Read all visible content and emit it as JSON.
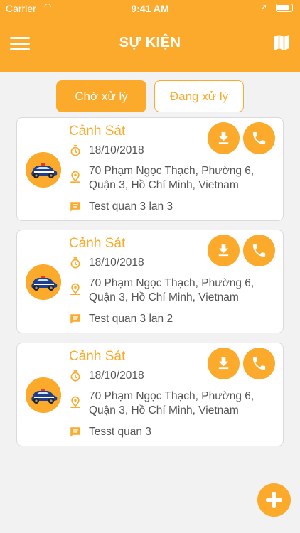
{
  "status_bar": {
    "carrier": "Carrier",
    "time": "9:41 AM"
  },
  "header": {
    "title": "SỰ KIỆN",
    "menu_icon": "hamburger-menu-icon",
    "map_icon": "map-icon"
  },
  "tabs": [
    {
      "label": "Chờ xử lý",
      "active": true
    },
    {
      "label": "Đang xử lý",
      "active": false
    }
  ],
  "events": [
    {
      "title": "Cảnh Sát",
      "date": "18/10/2018",
      "address": "70 Phạm Ngọc Thạch, Phường 6, Quận 3, Hồ Chí Minh, Vietnam",
      "note": "Test quan 3 lan 3"
    },
    {
      "title": "Cảnh Sát",
      "date": "18/10/2018",
      "address": "70 Phạm Ngọc Thạch, Phường 6, Quận 3, Hồ Chí Minh, Vietnam",
      "note": "Test quan 3 lan 2"
    },
    {
      "title": "Cảnh Sát",
      "date": "18/10/2018",
      "address": "70 Phạm Ngọc Thạch, Phường 6, Quận 3, Hồ Chí Minh, Vietnam",
      "note": "Tesst quan 3"
    }
  ],
  "colors": {
    "accent": "#fbaa2b",
    "background": "#f2f2f2",
    "text": "#555555"
  },
  "icons": {
    "date": "timer-icon",
    "location": "location-pin-icon",
    "note": "message-icon",
    "download": "download-icon",
    "call": "phone-icon",
    "add": "plus-icon",
    "avatar": "police-car-icon"
  }
}
